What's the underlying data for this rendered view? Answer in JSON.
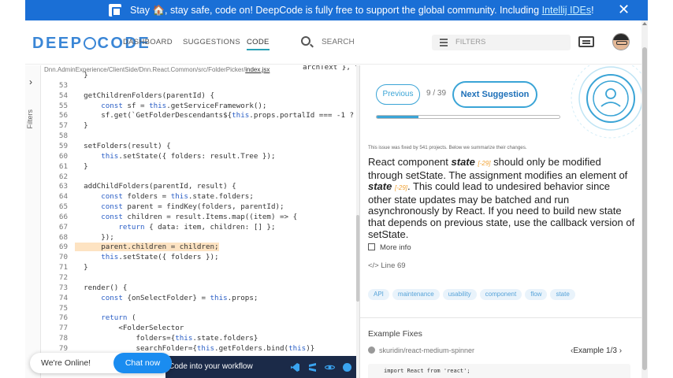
{
  "banner": {
    "message": "Stay 🏠, stay safe, code on! DeepCode is fully free to support the global community. Including ",
    "link": "Intellij IDEs",
    "suffix": "!",
    "close": "✕"
  },
  "header": {
    "brand_left": "DEEP",
    "brand_right": "CODE",
    "nav": [
      "DASHBOARD",
      "SUGGESTIONS",
      "CODE"
    ],
    "active_nav": "CODE",
    "search_placeholder": "SEARCH",
    "filters_label": "FILTERS"
  },
  "rail": {
    "expand": "›",
    "label": "Filters"
  },
  "code_panel": {
    "file_path": "Dnn.AdminExperience/ClientSide/Dnn.React.Common/src/FolderPicker/",
    "file_name": "index.jsx",
    "top_fragment": "archText }, this.se",
    "lines": [
      {
        "n": "",
        "t": "  }"
      },
      {
        "n": "53",
        "t": ""
      },
      {
        "n": "54",
        "t": "  getChildrenFolders(parentId) {"
      },
      {
        "n": "55",
        "t": "      const sf = this.getServiceFramework();"
      },
      {
        "n": "56",
        "t": "      sf.get(`GetFolderDescendants${this.props.portalId === -1 ?"
      },
      {
        "n": "57",
        "t": "  }"
      },
      {
        "n": "58",
        "t": ""
      },
      {
        "n": "59",
        "t": "  setFolders(result) {"
      },
      {
        "n": "60",
        "t": "      this.setState({ folders: result.Tree });"
      },
      {
        "n": "61",
        "t": "  }"
      },
      {
        "n": "62",
        "t": ""
      },
      {
        "n": "63",
        "t": "  addChildFolders(parentId, result) {"
      },
      {
        "n": "64",
        "t": "      const folders = this.state.folders;"
      },
      {
        "n": "65",
        "t": "      const parent = findKey(folders, parentId);"
      },
      {
        "n": "66",
        "t": "      const children = result.Items.map((item) => {"
      },
      {
        "n": "67",
        "t": "          return { data: item, children: [] };"
      },
      {
        "n": "68",
        "t": "      });"
      },
      {
        "n": "69",
        "t": "      parent.children = children;"
      },
      {
        "n": "70",
        "t": "      this.setState({ folders });"
      },
      {
        "n": "71",
        "t": "  }"
      },
      {
        "n": "72",
        "t": ""
      },
      {
        "n": "73",
        "t": "  render() {"
      },
      {
        "n": "74",
        "t": "      const {onSelectFolder} = this.props;"
      },
      {
        "n": "75",
        "t": ""
      },
      {
        "n": "76",
        "t": "      return ("
      },
      {
        "n": "77",
        "t": "          <FolderSelector"
      },
      {
        "n": "78",
        "t": "              folders={this.state.folders}"
      },
      {
        "n": "79",
        "t": "              searchFolder={this.getFolders.bind(this)}"
      },
      {
        "n": "80",
        "t": ""
      },
      {
        "n": "82",
        "t": ""
      }
    ],
    "highlight_line": "69"
  },
  "suggestion": {
    "prev_label": "Previous",
    "counter": "9 / 39",
    "next_label": "Next Suggestion",
    "progress_fraction": 0.23,
    "fixed_note": "This issue was fixed by 541 projects. Below we summarize their changes.",
    "desc_1": "React component ",
    "state_word": "state",
    "ref": "[-29]",
    "desc_2": " should only be modified through setState. The assignment modifies an element of ",
    "desc_3": ". This could lead to undesired behavior since other state updates may be batched and run asynchronously by React. If you need to build new state that depends on previous state, use the callback version of setState.",
    "more_info": "More info",
    "line_ref": "Line 69",
    "line_ref_icon": "</>",
    "tags": [
      "API",
      "maintenance",
      "usability",
      "component",
      "flow",
      "state"
    ]
  },
  "examples": {
    "title": "Example Fixes",
    "repo": "skuridin/react-medium-spinner",
    "nav": "‹Example 1/3 ›",
    "code": "import React from 'react';"
  },
  "chat": {
    "status": "We're Online!",
    "button": "Chat now"
  },
  "code_banner": {
    "text": "Code into your workflow"
  },
  "colors": {
    "accent": "#3aa4d6",
    "banner": "#1a6fd6",
    "tag_bg": "#e9f3fb"
  }
}
